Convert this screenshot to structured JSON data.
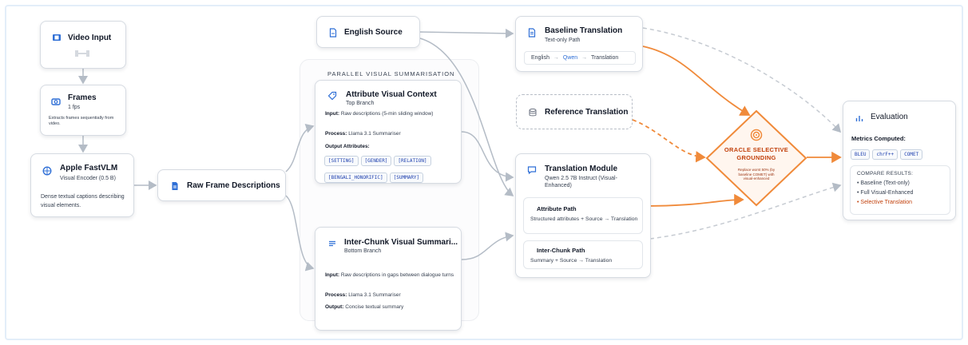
{
  "colors": {
    "accent": "#f08a3a",
    "blue_icon": "#2f6fd6",
    "connector": "#b4bcc6",
    "red_text": "#c2410c"
  },
  "group": {
    "label": "PARALLEL VISUAL SUMMARISATION"
  },
  "video": {
    "title": "Video Input",
    "icon": "film-icon"
  },
  "frames": {
    "title": "Frames",
    "rate": "1 fps",
    "desc": "Extracts frames sequentially from video."
  },
  "fastvlm": {
    "title": "Apple FastVLM",
    "subtitle": "Visual Encoder (0.5 B)",
    "desc": "Dense textual captions describing visual elements."
  },
  "raw": {
    "title": "Raw Frame Descriptions"
  },
  "english": {
    "title": "English Source"
  },
  "attr": {
    "title": "Attribute Visual Context",
    "subtitle": "Top Branch",
    "input_label": "Input:",
    "input": "Raw descriptions (5-min sliding window)",
    "process_label": "Process:",
    "process": "Llama 3.1 Summariser",
    "output_label": "Output Attributes:",
    "tags": [
      "[SETTING]",
      "[GENDER]",
      "[RELATION]",
      "[BENGALI_HONORIFIC]",
      "[SUMMARY]"
    ]
  },
  "inter": {
    "title": "Inter-Chunk Visual Summari...",
    "subtitle": "Bottom Branch",
    "input_label": "Input:",
    "input": "Raw descriptions in gaps between dialogue turns",
    "process_label": "Process:",
    "process": "Llama 3.1 Summariser",
    "output_label": "Output:",
    "output": "Concise textual summary"
  },
  "baseline": {
    "title": "Baseline Translation",
    "subtitle": "Text-only Path",
    "flow": {
      "a": "English",
      "b": "Qwen",
      "c": "Translation",
      "arrow": "→"
    }
  },
  "reference": {
    "title": "Reference Translation"
  },
  "translation": {
    "title": "Translation Module",
    "subtitle": "Qwen 2.5 7B Instruct (Visual-Enhanced)",
    "attr_path": {
      "title": "Attribute Path",
      "desc": "Structured attributes + Source → Translation"
    },
    "inter_path": {
      "title": "Inter-Chunk Path",
      "desc": "Summary + Source → Translation"
    }
  },
  "oracle": {
    "title_line1": "ORACLE SELECTIVE",
    "title_line2": "GROUNDING",
    "note": "Replace worst 50% (by baseline COMET) with visual-enhanced"
  },
  "evaluation": {
    "title": "Evaluation",
    "metrics_label": "Metrics Computed:",
    "metrics": [
      "BLEU",
      "chrF++",
      "COMET"
    ],
    "compare_label": "COMPARE RESULTS:",
    "results": [
      "Baseline (Text-only)",
      "Full Visual-Enhanced",
      "Selective Translation"
    ]
  }
}
